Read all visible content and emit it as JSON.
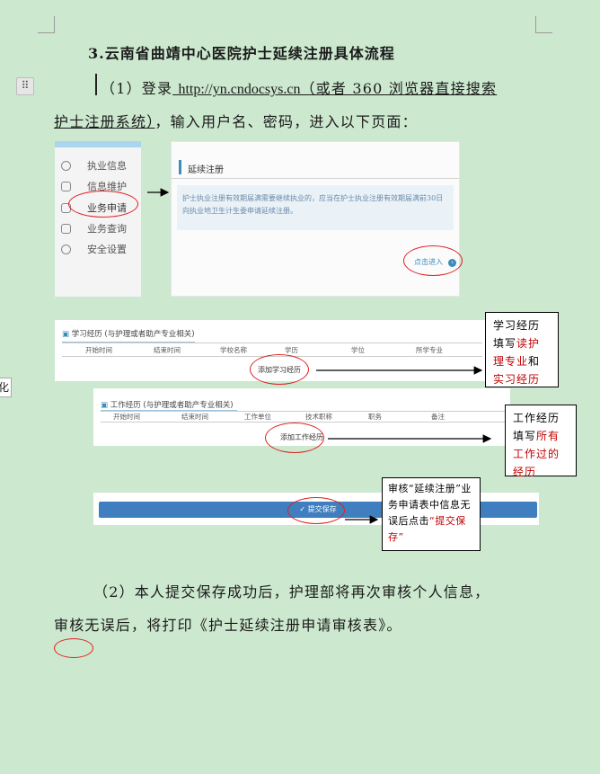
{
  "heading": "3.云南省曲靖中心医院护士延续注册具体流程",
  "step1": {
    "prefix": "（1）登录",
    "url": "http://yn.cndocsys.cn",
    "suffix": "（或者 360 浏览器直接搜索",
    "line2_underlined": "护士注册系统）",
    "line2_rest": "，输入用户名、密码，进入以下页面："
  },
  "side_menu": [
    {
      "label": "执业信息",
      "icon": "headset-icon"
    },
    {
      "label": "信息维护",
      "icon": "info-icon"
    },
    {
      "label": "业务申请",
      "icon": "form-icon"
    },
    {
      "label": "业务查询",
      "icon": "query-icon"
    },
    {
      "label": "安全设置",
      "icon": "user-lock-icon"
    }
  ],
  "panel": {
    "title": "延续注册",
    "notice": "护士执业注册有效期届满需要继续执业的，应当在护士执业注册有效期届满前30日向执业地卫生计生委申请延续注册。",
    "enter_button": "点击进入"
  },
  "study_form": {
    "title": "学习经历 (与护理或者助产专业相关)",
    "columns": [
      "开始时间",
      "结束时间",
      "学校名称",
      "学历",
      "学位",
      "所学专业"
    ],
    "add_button": "添加学习经历"
  },
  "work_form": {
    "title": "工作经历 (与护理或者助产专业相关)",
    "columns": [
      "开始时间",
      "结束时间",
      "工作单位",
      "技术职称",
      "职务",
      "备注"
    ],
    "add_button": "添加工作经历"
  },
  "submit_button": "提交保存",
  "notes": {
    "study": {
      "pre": "学习经历填写",
      "red": "读护理专业",
      "mid": "和",
      "red2": "实习经历"
    },
    "work": {
      "pre": "工作经历填写",
      "red": "所有工作过的经历"
    },
    "submit": {
      "pre": "审核“延续注册”业务申请表中信息无误后点击",
      "red": "“提交保存”"
    }
  },
  "step2": {
    "line1": "（2）本人提交保存成功后，护理部将再次审核个人信息，",
    "line2": "审核无误后，将打印《护士延续注册申请审核表》。"
  },
  "side_tag": "化",
  "colors": {
    "page_bg": "#cce8cf",
    "accent_blue": "#3c8dbc",
    "annotation_red": "#e02020",
    "note_red": "#c00000"
  }
}
